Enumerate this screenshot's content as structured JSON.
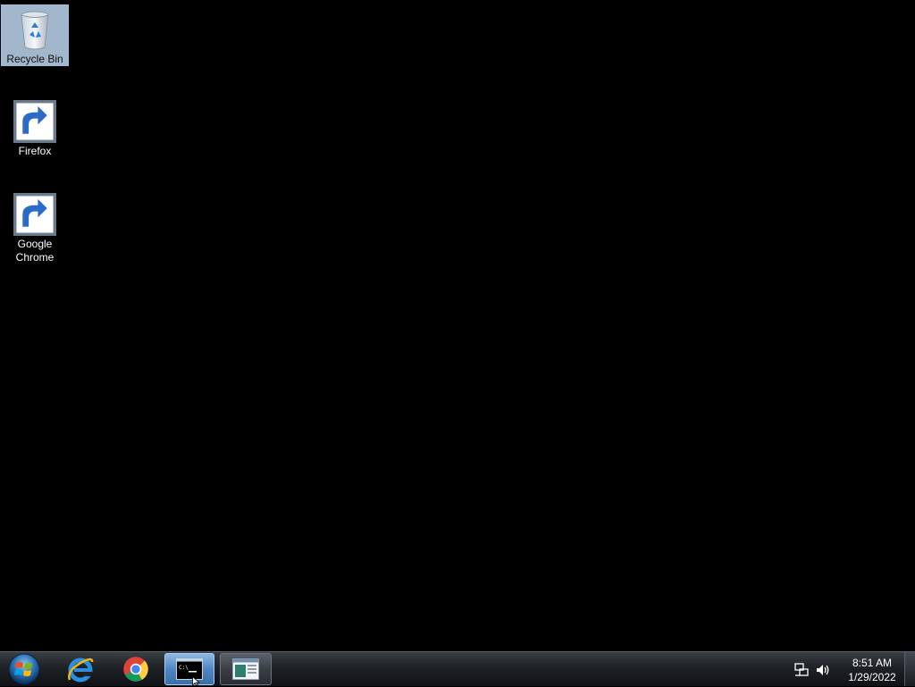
{
  "desktop": {
    "icons": [
      {
        "label": "Recycle Bin",
        "icon": "recycle-bin-icon",
        "selected": true
      },
      {
        "label": "Firefox",
        "icon": "firefox-icon",
        "shortcut": true
      },
      {
        "label": "Google Chrome",
        "icon": "chrome-icon",
        "shortcut": true
      }
    ]
  },
  "taskbar": {
    "start_icon": "windows-start-icon",
    "pinned": [
      {
        "name": "Internet Explorer",
        "icon": "ie-icon"
      },
      {
        "name": "Google Chrome",
        "icon": "chrome-icon"
      },
      {
        "name": "Command Prompt",
        "icon": "cmd-icon",
        "active": true
      },
      {
        "name": "Window",
        "icon": "window-icon"
      }
    ],
    "tray": {
      "icons": [
        "network-icon",
        "volume-icon"
      ],
      "time": "8:51 AM",
      "date": "1/29/2022"
    }
  },
  "colors": {
    "desktop_background": "#000000",
    "selection": "#bed7f0",
    "taskbar": "#1e2226"
  }
}
